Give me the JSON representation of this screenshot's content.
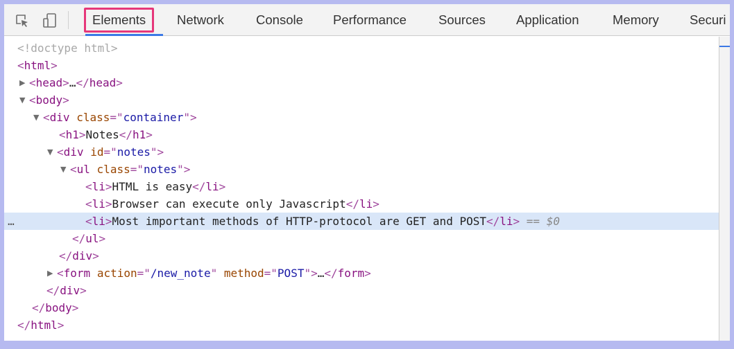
{
  "toolbar": {
    "icons": [
      "inspect-element-icon",
      "device-toolbar-icon"
    ],
    "tabs": [
      {
        "label": "Elements",
        "active": true
      },
      {
        "label": "Network"
      },
      {
        "label": "Console"
      },
      {
        "label": "Performance"
      },
      {
        "label": "Sources"
      },
      {
        "label": "Application"
      },
      {
        "label": "Memory"
      },
      {
        "label": "Securi"
      }
    ]
  },
  "dom": {
    "doctype": "<!doctype html>",
    "html_open": "html",
    "html_close": "html",
    "head": {
      "tag": "head",
      "collapsed_text": "…"
    },
    "body": {
      "tag": "body"
    },
    "container": {
      "tag": "div",
      "attr": "class",
      "value": "container"
    },
    "h1": {
      "tag": "h1",
      "text": "Notes"
    },
    "notes_div": {
      "tag": "div",
      "attr": "id",
      "value": "notes"
    },
    "ul": {
      "tag": "ul",
      "attr": "class",
      "value": "notes"
    },
    "li1": {
      "tag": "li",
      "text": "HTML is easy"
    },
    "li2": {
      "tag": "li",
      "text": "Browser can execute only Javascript"
    },
    "li3": {
      "tag": "li",
      "text": "Most important methods of HTTP-protocol are GET and POST"
    },
    "selected_marker": "== $0",
    "gutter_dots": "…",
    "form": {
      "tag": "form",
      "attr1": "action",
      "value1": "/new_note",
      "attr2": "method",
      "value2": "POST",
      "collapsed_text": "…"
    }
  },
  "colors": {
    "tag": "#881280",
    "attr": "#994500",
    "value": "#1a1aa6",
    "highlight_border": "#e6377a",
    "selection": "#d9e6f8",
    "frame": "#b6baf0"
  }
}
